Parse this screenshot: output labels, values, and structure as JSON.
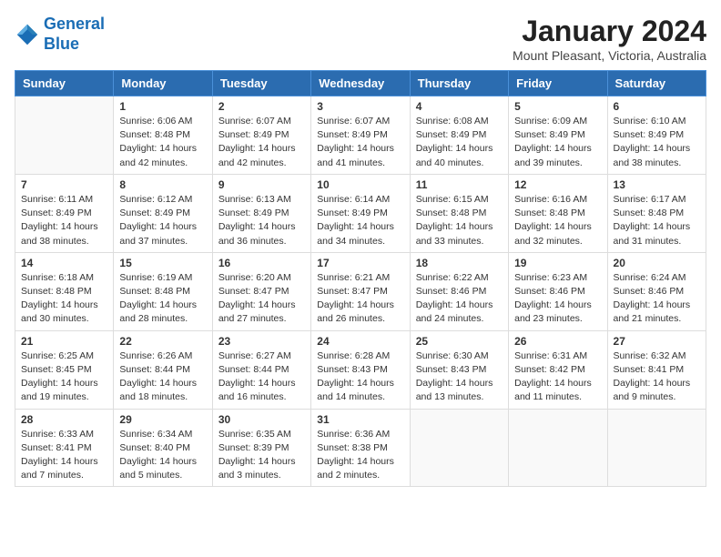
{
  "header": {
    "logo_line1": "General",
    "logo_line2": "Blue",
    "month_title": "January 2024",
    "location": "Mount Pleasant, Victoria, Australia"
  },
  "weekdays": [
    "Sunday",
    "Monday",
    "Tuesday",
    "Wednesday",
    "Thursday",
    "Friday",
    "Saturday"
  ],
  "weeks": [
    [
      {
        "day": "",
        "info": ""
      },
      {
        "day": "1",
        "info": "Sunrise: 6:06 AM\nSunset: 8:48 PM\nDaylight: 14 hours\nand 42 minutes."
      },
      {
        "day": "2",
        "info": "Sunrise: 6:07 AM\nSunset: 8:49 PM\nDaylight: 14 hours\nand 42 minutes."
      },
      {
        "day": "3",
        "info": "Sunrise: 6:07 AM\nSunset: 8:49 PM\nDaylight: 14 hours\nand 41 minutes."
      },
      {
        "day": "4",
        "info": "Sunrise: 6:08 AM\nSunset: 8:49 PM\nDaylight: 14 hours\nand 40 minutes."
      },
      {
        "day": "5",
        "info": "Sunrise: 6:09 AM\nSunset: 8:49 PM\nDaylight: 14 hours\nand 39 minutes."
      },
      {
        "day": "6",
        "info": "Sunrise: 6:10 AM\nSunset: 8:49 PM\nDaylight: 14 hours\nand 38 minutes."
      }
    ],
    [
      {
        "day": "7",
        "info": "Sunrise: 6:11 AM\nSunset: 8:49 PM\nDaylight: 14 hours\nand 38 minutes."
      },
      {
        "day": "8",
        "info": "Sunrise: 6:12 AM\nSunset: 8:49 PM\nDaylight: 14 hours\nand 37 minutes."
      },
      {
        "day": "9",
        "info": "Sunrise: 6:13 AM\nSunset: 8:49 PM\nDaylight: 14 hours\nand 36 minutes."
      },
      {
        "day": "10",
        "info": "Sunrise: 6:14 AM\nSunset: 8:49 PM\nDaylight: 14 hours\nand 34 minutes."
      },
      {
        "day": "11",
        "info": "Sunrise: 6:15 AM\nSunset: 8:48 PM\nDaylight: 14 hours\nand 33 minutes."
      },
      {
        "day": "12",
        "info": "Sunrise: 6:16 AM\nSunset: 8:48 PM\nDaylight: 14 hours\nand 32 minutes."
      },
      {
        "day": "13",
        "info": "Sunrise: 6:17 AM\nSunset: 8:48 PM\nDaylight: 14 hours\nand 31 minutes."
      }
    ],
    [
      {
        "day": "14",
        "info": "Sunrise: 6:18 AM\nSunset: 8:48 PM\nDaylight: 14 hours\nand 30 minutes."
      },
      {
        "day": "15",
        "info": "Sunrise: 6:19 AM\nSunset: 8:48 PM\nDaylight: 14 hours\nand 28 minutes."
      },
      {
        "day": "16",
        "info": "Sunrise: 6:20 AM\nSunset: 8:47 PM\nDaylight: 14 hours\nand 27 minutes."
      },
      {
        "day": "17",
        "info": "Sunrise: 6:21 AM\nSunset: 8:47 PM\nDaylight: 14 hours\nand 26 minutes."
      },
      {
        "day": "18",
        "info": "Sunrise: 6:22 AM\nSunset: 8:46 PM\nDaylight: 14 hours\nand 24 minutes."
      },
      {
        "day": "19",
        "info": "Sunrise: 6:23 AM\nSunset: 8:46 PM\nDaylight: 14 hours\nand 23 minutes."
      },
      {
        "day": "20",
        "info": "Sunrise: 6:24 AM\nSunset: 8:46 PM\nDaylight: 14 hours\nand 21 minutes."
      }
    ],
    [
      {
        "day": "21",
        "info": "Sunrise: 6:25 AM\nSunset: 8:45 PM\nDaylight: 14 hours\nand 19 minutes."
      },
      {
        "day": "22",
        "info": "Sunrise: 6:26 AM\nSunset: 8:44 PM\nDaylight: 14 hours\nand 18 minutes."
      },
      {
        "day": "23",
        "info": "Sunrise: 6:27 AM\nSunset: 8:44 PM\nDaylight: 14 hours\nand 16 minutes."
      },
      {
        "day": "24",
        "info": "Sunrise: 6:28 AM\nSunset: 8:43 PM\nDaylight: 14 hours\nand 14 minutes."
      },
      {
        "day": "25",
        "info": "Sunrise: 6:30 AM\nSunset: 8:43 PM\nDaylight: 14 hours\nand 13 minutes."
      },
      {
        "day": "26",
        "info": "Sunrise: 6:31 AM\nSunset: 8:42 PM\nDaylight: 14 hours\nand 11 minutes."
      },
      {
        "day": "27",
        "info": "Sunrise: 6:32 AM\nSunset: 8:41 PM\nDaylight: 14 hours\nand 9 minutes."
      }
    ],
    [
      {
        "day": "28",
        "info": "Sunrise: 6:33 AM\nSunset: 8:41 PM\nDaylight: 14 hours\nand 7 minutes."
      },
      {
        "day": "29",
        "info": "Sunrise: 6:34 AM\nSunset: 8:40 PM\nDaylight: 14 hours\nand 5 minutes."
      },
      {
        "day": "30",
        "info": "Sunrise: 6:35 AM\nSunset: 8:39 PM\nDaylight: 14 hours\nand 3 minutes."
      },
      {
        "day": "31",
        "info": "Sunrise: 6:36 AM\nSunset: 8:38 PM\nDaylight: 14 hours\nand 2 minutes."
      },
      {
        "day": "",
        "info": ""
      },
      {
        "day": "",
        "info": ""
      },
      {
        "day": "",
        "info": ""
      }
    ]
  ]
}
